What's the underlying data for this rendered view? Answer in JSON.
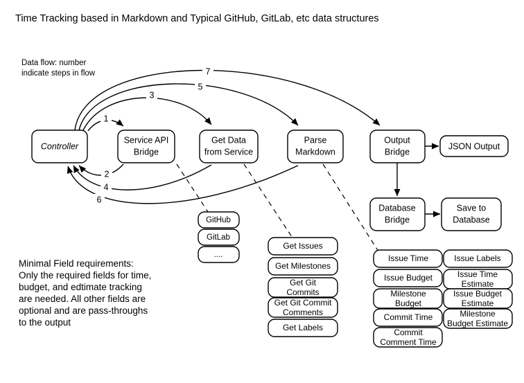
{
  "title": "Time Tracking based in Markdown and Typical GitHub, GitLab, etc data structures",
  "legend": {
    "line1": "Data flow: number",
    "line2": "indicate steps in flow"
  },
  "note": {
    "line1": "Minimal Field requirements:",
    "line2": "Only the required fields for time,",
    "line3": "budget, and edtimate tracking",
    "line4": "are needed.  All other fields are",
    "line5": "optional and are pass-throughs",
    "line6": "to the output"
  },
  "nodes": {
    "controller": "Controller",
    "service_api_bridge_l1": "Service API",
    "service_api_bridge_l2": "Bridge",
    "get_data_l1": "Get Data",
    "get_data_l2": "from Service",
    "parse_markdown_l1": "Parse",
    "parse_markdown_l2": "Markdown",
    "output_bridge_l1": "Output",
    "output_bridge_l2": "Bridge",
    "json_output": "JSON Output",
    "database_bridge_l1": "Database",
    "database_bridge_l2": "Bridge",
    "save_to_database_l1": "Save to",
    "save_to_database_l2": "Database"
  },
  "services": [
    {
      "label": "GitHub"
    },
    {
      "label": "GitLab"
    },
    {
      "label": "...."
    }
  ],
  "operations": [
    {
      "line1": "Get Issues",
      "line2": ""
    },
    {
      "line1": "Get Milestones",
      "line2": ""
    },
    {
      "line1": "Get  Git",
      "line2": "Commits"
    },
    {
      "line1": "Get Git Commit",
      "line2": "Comments"
    },
    {
      "line1": "Get Labels",
      "line2": ""
    }
  ],
  "fields_left": [
    {
      "line1": "Issue Time",
      "line2": ""
    },
    {
      "line1": "Issue Budget",
      "line2": ""
    },
    {
      "line1": "Milestone",
      "line2": "Budget"
    },
    {
      "line1": "Commit Time",
      "line2": ""
    },
    {
      "line1": "Commit",
      "line2": "Comment Time"
    }
  ],
  "fields_right": [
    {
      "line1": "Issue Labels",
      "line2": ""
    },
    {
      "line1": "Issue Time",
      "line2": "Estimate"
    },
    {
      "line1": "Issue Budget",
      "line2": "Estimate"
    },
    {
      "line1": "Milestone",
      "line2": "Budget Estimate"
    }
  ],
  "flow_numbers": {
    "step1": "1",
    "step2": "2",
    "step3": "3",
    "step4": "4",
    "step5": "5",
    "step6": "6",
    "step7": "7"
  },
  "colors": {
    "stroke": "#000000",
    "background": "#ffffff"
  }
}
